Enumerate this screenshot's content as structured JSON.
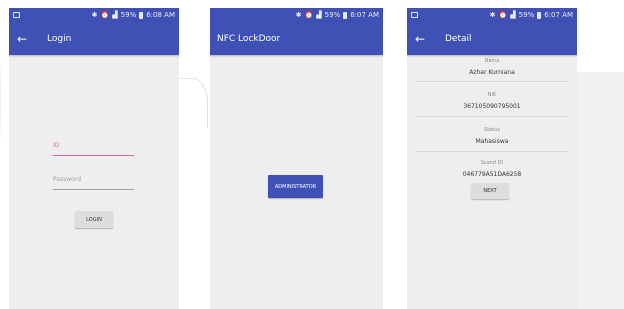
{
  "status_bar": {
    "time_p1": "6:08 AM",
    "time_p2": "6:07 AM",
    "time_p3": "6:07 AM",
    "battery": "59%"
  },
  "login_screen": {
    "title": "Login",
    "id_label": "ID",
    "password_label": "Password",
    "button": "LOGIN"
  },
  "lock_screen": {
    "title": "NFC LockDoor",
    "button": "ADMINISTRATOR"
  },
  "detail_screen": {
    "title": "Detail",
    "items": [
      {
        "label": "Nama",
        "value": "Azhar Kurniana"
      },
      {
        "label": "NIK",
        "value": "367105090795001"
      },
      {
        "label": "Status",
        "value": "Mahasiswa"
      },
      {
        "label": "Scand ID",
        "value": "046779A51DA6258"
      }
    ],
    "button": "NEXT"
  },
  "colors": {
    "primary": "#3f51b5",
    "accent": "#f06292",
    "background": "#eeeeee"
  },
  "icons": [
    "save-icon",
    "bluetooth-icon",
    "alarm-icon",
    "signal-icon",
    "battery-icon",
    "back-arrow-icon"
  ]
}
